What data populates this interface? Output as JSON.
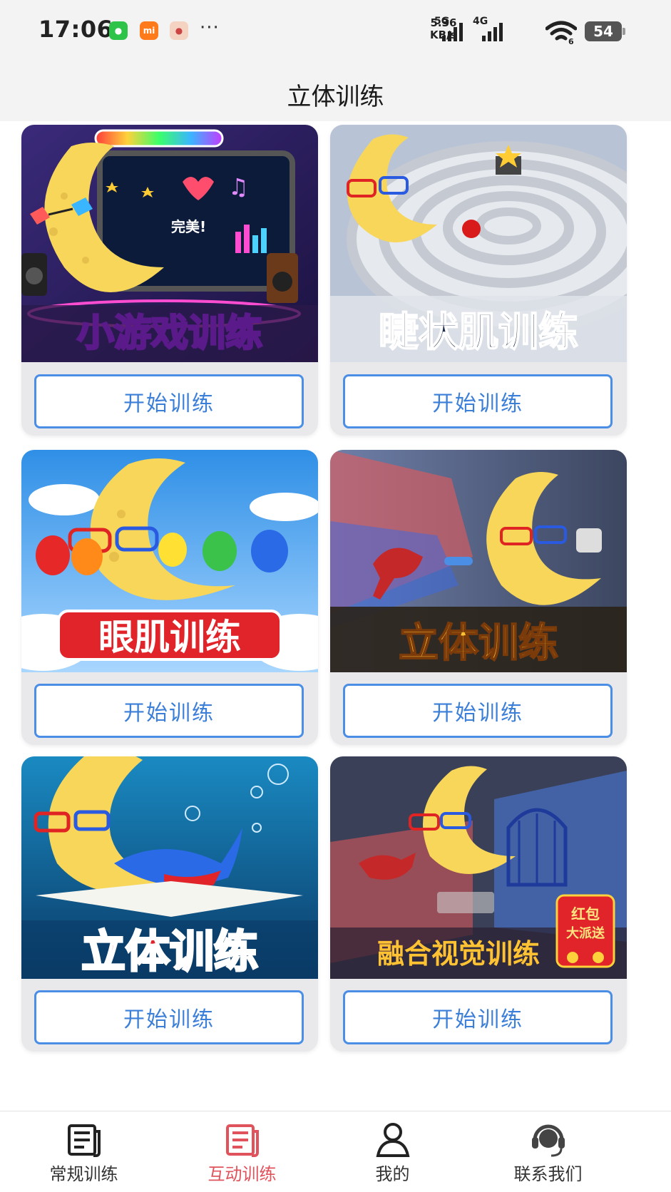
{
  "status_bar": {
    "time": "17:06",
    "net_speed_value": "5.36",
    "net_speed_unit": "KB/s",
    "network_1": "5G",
    "network_2": "4G",
    "wifi_label": "6",
    "battery": "54"
  },
  "header": {
    "title": "立体训练"
  },
  "cards": [
    {
      "art_label": "小游戏训练",
      "art_overlay": "完美!",
      "button": "开始训练"
    },
    {
      "art_label": "睫状肌训练",
      "button": "开始训练"
    },
    {
      "art_label": "眼肌训练",
      "button": "开始训练"
    },
    {
      "art_label": "立体训练",
      "button": "开始训练"
    },
    {
      "art_label": "立体训练",
      "button": "开始训练"
    },
    {
      "art_label": "融合视觉训练",
      "art_badge_line1": "红包",
      "art_badge_line2": "大派送",
      "button": "开始训练"
    }
  ],
  "bottom_nav": [
    {
      "label": "常规训练",
      "icon": "document-icon",
      "active": false
    },
    {
      "label": "互动训练",
      "icon": "document-icon",
      "active": true
    },
    {
      "label": "我的",
      "icon": "person-icon",
      "active": false
    },
    {
      "label": "联系我们",
      "icon": "headset-icon",
      "active": false
    }
  ],
  "colors": {
    "accent_blue": "#4b8ee6",
    "active_nav": "#e0535c",
    "card_bg": "#e9e9ec"
  }
}
